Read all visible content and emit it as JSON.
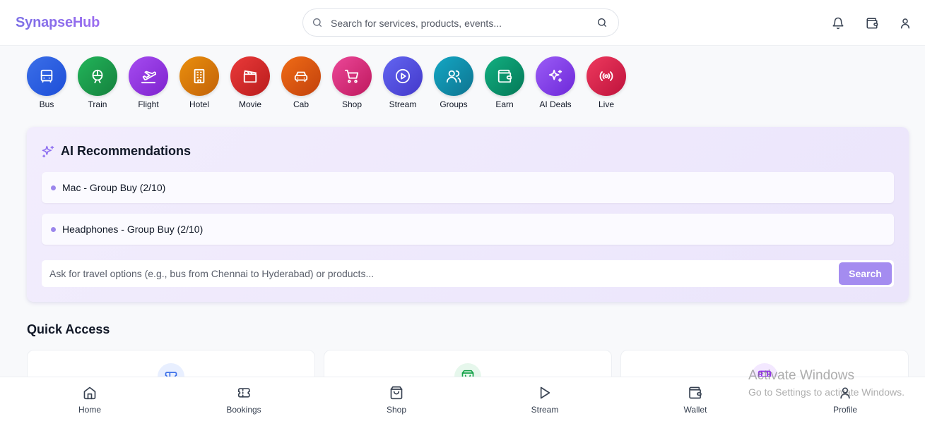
{
  "app": {
    "logo": "SynapseHub"
  },
  "header": {
    "search_placeholder": "Search for services, products, events...",
    "icons": [
      "bell-icon",
      "wallet-icon",
      "user-icon"
    ]
  },
  "services": [
    {
      "label": "Bus",
      "icon": "bus-icon",
      "colors": [
        "#3b6fe8",
        "#1d4ed8"
      ]
    },
    {
      "label": "Train",
      "icon": "train-icon",
      "colors": [
        "#22b55a",
        "#15803d"
      ]
    },
    {
      "label": "Flight",
      "icon": "plane-icon",
      "colors": [
        "#a54cf0",
        "#7e22ce"
      ]
    },
    {
      "label": "Hotel",
      "icon": "hotel-icon",
      "colors": [
        "#ea8f0c",
        "#c2620a"
      ]
    },
    {
      "label": "Movie",
      "icon": "clapperboard-icon",
      "colors": [
        "#ea3a3a",
        "#b91c1c"
      ]
    },
    {
      "label": "Cab",
      "icon": "car-icon",
      "colors": [
        "#f06c16",
        "#c2410c"
      ]
    },
    {
      "label": "Shop",
      "icon": "cart-icon",
      "colors": [
        "#ec4899",
        "#be185d"
      ]
    },
    {
      "label": "Stream",
      "icon": "play-circle-icon",
      "colors": [
        "#6366f1",
        "#4338ca"
      ]
    },
    {
      "label": "Groups",
      "icon": "users-icon",
      "colors": [
        "#14a7c4",
        "#0e7490"
      ]
    },
    {
      "label": "Earn",
      "icon": "wallet-icon",
      "colors": [
        "#12b081",
        "#047857"
      ]
    },
    {
      "label": "AI Deals",
      "icon": "sparkles-icon",
      "colors": [
        "#9b5cf6",
        "#6d28d9"
      ]
    },
    {
      "label": "Live",
      "icon": "broadcast-icon",
      "colors": [
        "#ee3a5e",
        "#be123c"
      ]
    }
  ],
  "ai": {
    "title": "AI Recommendations",
    "recommendations": [
      "Mac - Group Buy (2/10)",
      "Headphones - Group Buy (2/10)"
    ],
    "input_placeholder": "Ask for travel options (e.g., bus from Chennai to Hyderabad) or products...",
    "button": "Search",
    "accent": "#a48cf0"
  },
  "quick_access": {
    "title": "Quick Access",
    "cards": [
      {
        "icon": "ticket-icon",
        "color": "#3b6fe8",
        "bg": "#e8efff"
      },
      {
        "icon": "bag-icon",
        "color": "#16a34a",
        "bg": "#e6f7ec"
      },
      {
        "icon": "film-icon",
        "color": "#9333ea",
        "bg": "#f3e8ff"
      }
    ]
  },
  "watermark": {
    "line1": "Activate Windows",
    "line2": "Go to Settings to activate Windows."
  },
  "bottom_nav": [
    {
      "label": "Home",
      "icon": "home-icon"
    },
    {
      "label": "Bookings",
      "icon": "ticket-icon"
    },
    {
      "label": "Shop",
      "icon": "bag-icon"
    },
    {
      "label": "Stream",
      "icon": "play-icon"
    },
    {
      "label": "Wallet",
      "icon": "wallet-icon"
    },
    {
      "label": "Profile",
      "icon": "user-icon"
    }
  ]
}
